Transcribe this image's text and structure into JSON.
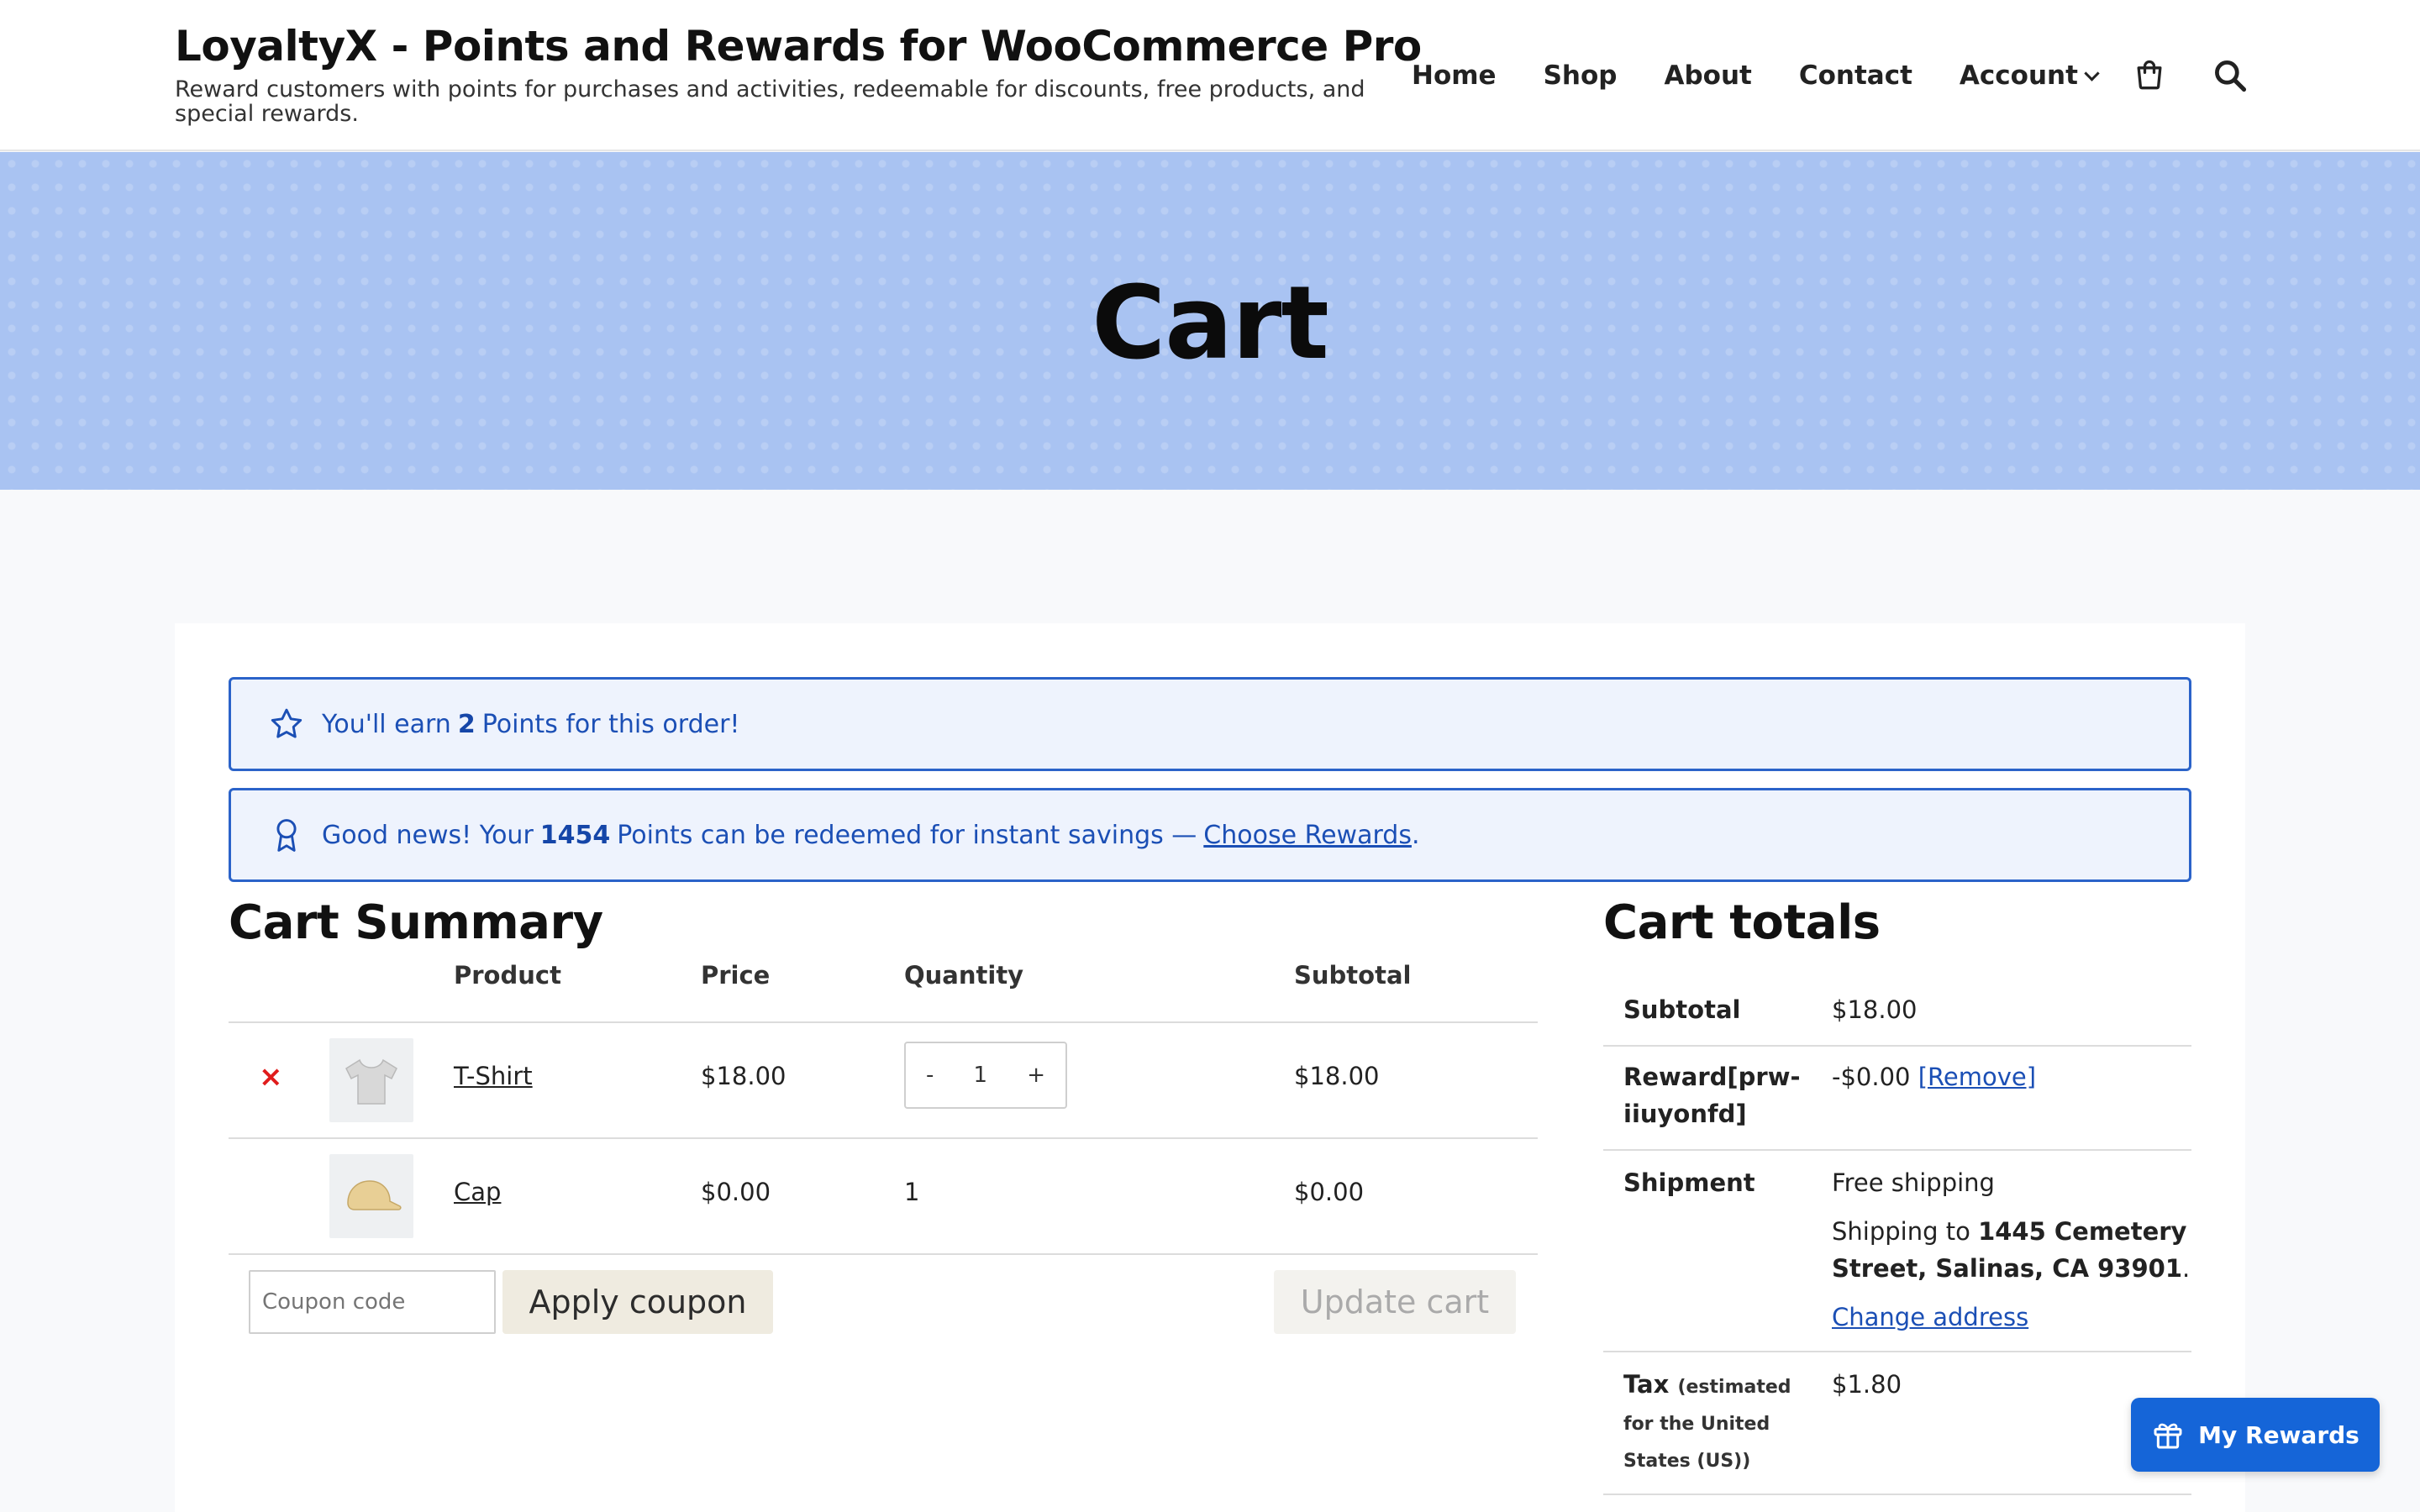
{
  "header": {
    "site_title": "LoyaltyX - Points and Rewards for WooCommerce Pro",
    "tagline": "Reward customers with points for purchases and activities, redeemable for discounts, free products, and special rewards.",
    "nav": {
      "home": "Home",
      "shop": "Shop",
      "about": "About",
      "contact": "Contact",
      "account": "Account"
    },
    "icons": [
      "cart-icon",
      "search-icon"
    ]
  },
  "hero": {
    "title": "Cart"
  },
  "notices": {
    "earn": {
      "prefix": "You'll earn",
      "points": "2",
      "suffix": "Points for this order!"
    },
    "redeem": {
      "prefix": "Good news! Your",
      "points": "1454",
      "middle": "Points can be redeemed for instant savings —",
      "link": "Choose Rewards",
      "end": "."
    }
  },
  "cart": {
    "title": "Cart Summary",
    "headers": {
      "product": "Product",
      "price": "Price",
      "quantity": "Quantity",
      "subtotal": "Subtotal"
    },
    "rows": [
      {
        "product": "T-Shirt",
        "price": "$18.00",
        "quantity": "1",
        "subtotal": "$18.00",
        "remove": "×",
        "minus": "-",
        "plus": "+"
      },
      {
        "product": "Cap",
        "price": "$0.00",
        "quantity": "1",
        "subtotal": "$0.00"
      }
    ],
    "coupon_placeholder": "Coupon code",
    "apply_coupon": "Apply coupon",
    "update_cart": "Update cart"
  },
  "totals": {
    "title": "Cart totals",
    "subtotal_label": "Subtotal",
    "subtotal_value": "$18.00",
    "reward_label_1": "Reward[prw-",
    "reward_label_2": "iiuyonfd]",
    "reward_value": "-$0.00",
    "reward_remove": "[Remove]",
    "shipment_label": "Shipment",
    "shipment_method": "Free shipping",
    "shipping_to_prefix": "Shipping to",
    "shipping_address_1": "1445 Cemetery",
    "shipping_address_2": "Street, Salinas, CA 93901",
    "shipping_end": ".",
    "change_address": "Change address",
    "tax_label": "Tax",
    "tax_note_1": "(estimated",
    "tax_note_2": "for the United",
    "tax_note_3": "States (US))",
    "tax_value": "$1.80"
  },
  "floating": {
    "my_rewards": "My Rewards"
  },
  "colors": {
    "accent": "#1565d8",
    "notice_border": "#2b63c9",
    "hero_bg": "#a9c3f2",
    "remove": "#e01c1c"
  }
}
